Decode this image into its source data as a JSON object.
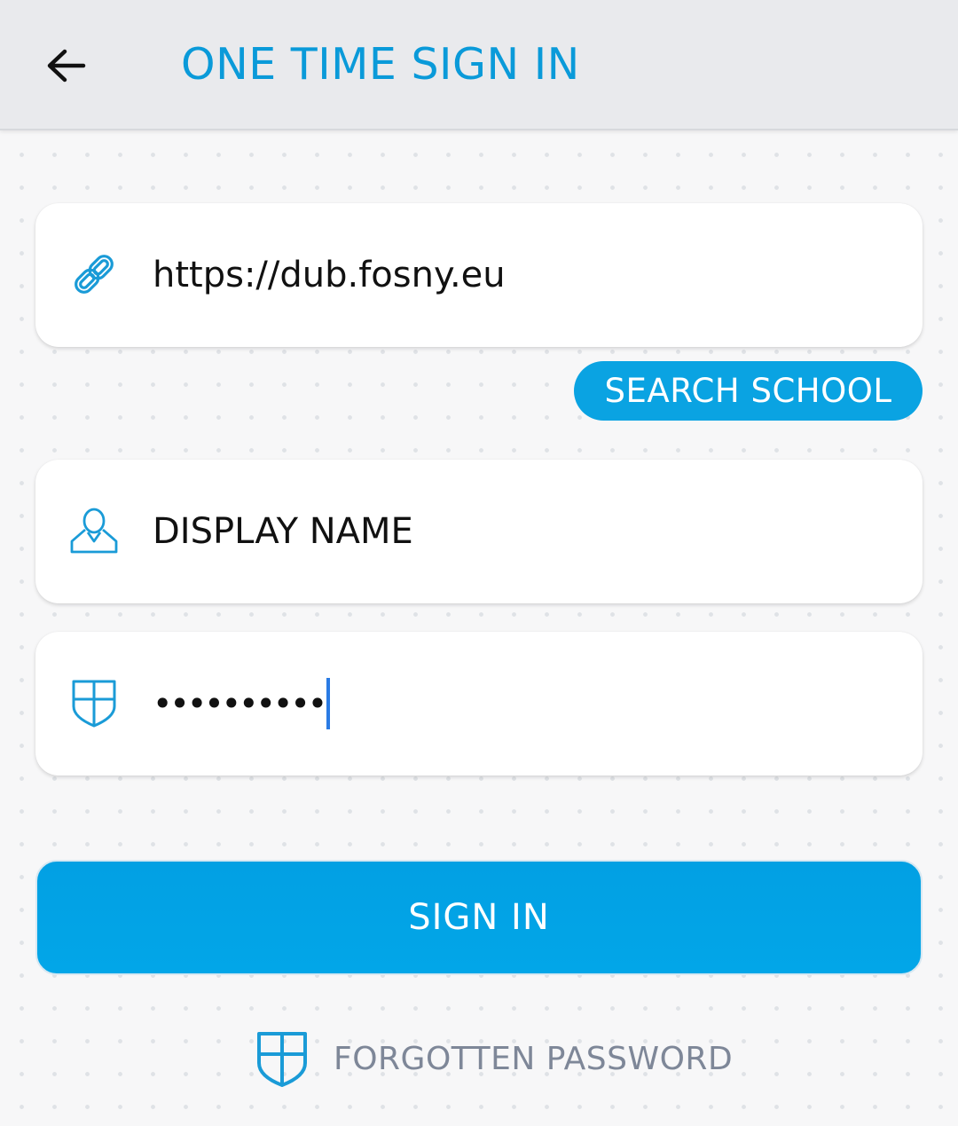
{
  "header": {
    "back_icon": "arrow-left-icon",
    "title": "ONE TIME SIGN IN"
  },
  "form": {
    "url_icon": "link-icon",
    "url_value": "https://dub.fosny.eu",
    "search_school_label": "SEARCH SCHOOL",
    "name_icon": "user-icon",
    "name_placeholder": "DISPLAY NAME",
    "password_icon": "shield-icon",
    "password_value": "••••••••••",
    "sign_in_label": "SIGN IN"
  },
  "footer": {
    "forgot_icon": "shield-icon",
    "forgot_label": "FORGOTTEN PASSWORD"
  },
  "colors": {
    "accent": "#0AA3E2",
    "header_bg": "#E9EAED",
    "muted_text": "#7E8798"
  }
}
